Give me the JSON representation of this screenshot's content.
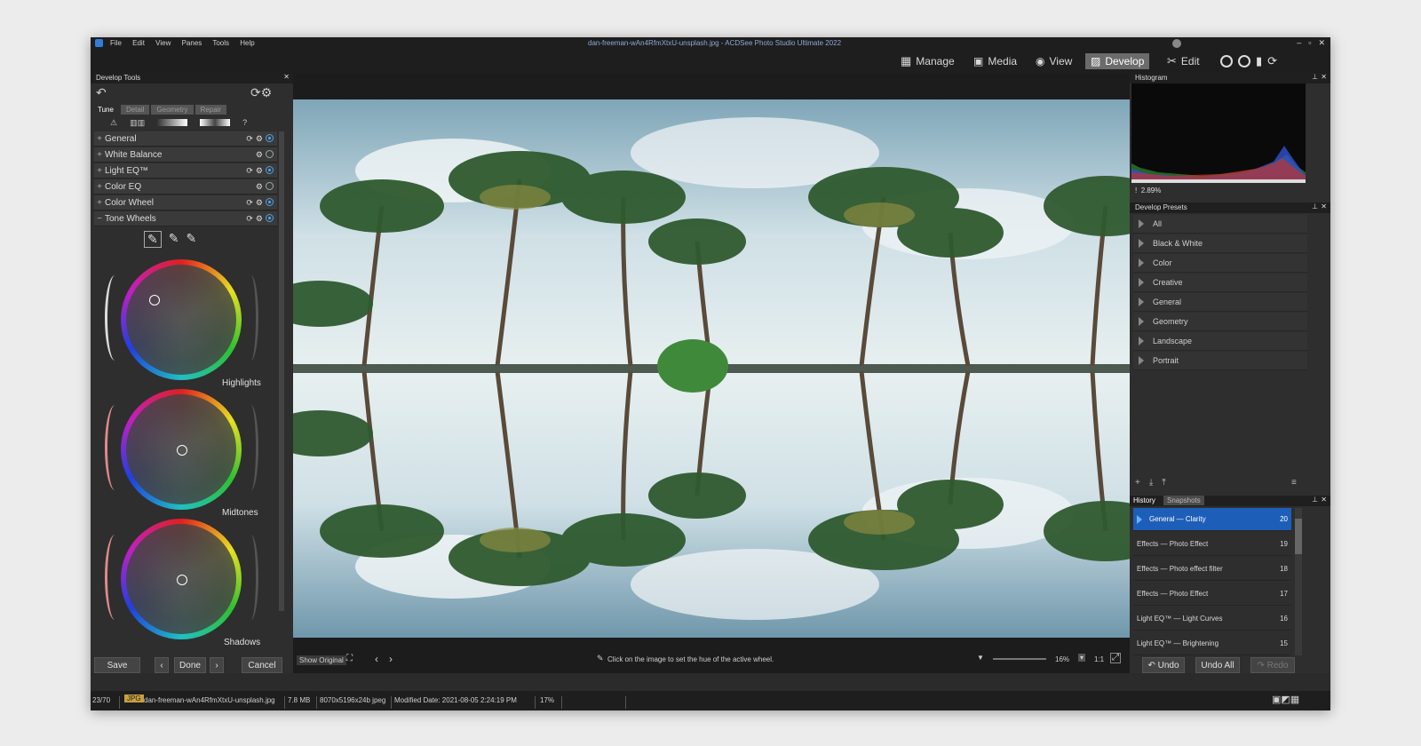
{
  "window": {
    "title": "dan-freeman-wAn4RfmXtxU-unsplash.jpg - ACDSee Photo Studio Ultimate 2022",
    "menu": [
      "File",
      "Edit",
      "View",
      "Panes",
      "Tools",
      "Help"
    ]
  },
  "modes": [
    {
      "label": "Manage",
      "icon": "grid-icon"
    },
    {
      "label": "Media",
      "icon": "media-icon"
    },
    {
      "label": "View",
      "icon": "eye-icon"
    },
    {
      "label": "Develop",
      "icon": "develop-icon",
      "active": true
    },
    {
      "label": "Edit",
      "icon": "edit-icon"
    }
  ],
  "develop_tools": {
    "header": "Develop Tools",
    "tabs": [
      "Tune",
      "Detail",
      "Geometry",
      "Repair"
    ],
    "groups": [
      "General",
      "White Balance",
      "Light EQ™",
      "Color EQ",
      "Color Wheel",
      "Tone Wheels"
    ],
    "wheels": [
      "Highlights",
      "Midtones",
      "Shadows"
    ],
    "buttons": {
      "save": "Save",
      "done": "Done",
      "cancel": "Cancel"
    }
  },
  "image_toolbar": {
    "show_original": "Show Original",
    "hint": "Click on the image to set the hue of the active wheel.",
    "zoom": "16%",
    "ratio": "1:1"
  },
  "histogram": {
    "header": "Histogram",
    "value": "2.89%"
  },
  "presets": {
    "header": "Develop Presets",
    "items": [
      "All",
      "Black & White",
      "Color",
      "Creative",
      "General",
      "Geometry",
      "Landscape",
      "Portrait"
    ]
  },
  "history": {
    "tabs": [
      "History",
      "Snapshots"
    ],
    "items": [
      {
        "label": "General — Clarity",
        "n": "20"
      },
      {
        "label": "Effects — Photo Effect",
        "n": "19"
      },
      {
        "label": "Effects — Photo effect filter",
        "n": "18"
      },
      {
        "label": "Effects — Photo Effect",
        "n": "17"
      },
      {
        "label": "Light EQ™ — Light Curves",
        "n": "16"
      },
      {
        "label": "Light EQ™ — Brightening",
        "n": "15"
      }
    ],
    "buttons": {
      "undo": "Undo",
      "undo_all": "Undo All",
      "redo": "Redo"
    }
  },
  "status": {
    "count": "23/70",
    "type": "JPG",
    "file": "dan-freeman-wAn4RfmXtxU-unsplash.jpg",
    "size": "7.8 MB",
    "dims": "8070x5196x24b jpeg",
    "modified": "Modified Date: 2021-08-05 2:24:19 PM",
    "zoom": "17%"
  },
  "colors": {
    "accent": "#1d5fb8",
    "panel": "#2e2e2e",
    "titlebar": "#1e1e1e"
  }
}
